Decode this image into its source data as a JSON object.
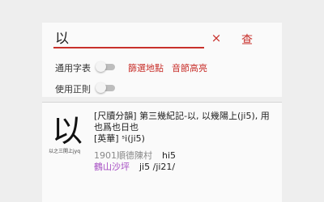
{
  "search": {
    "value": "以",
    "clear_icon": "×",
    "search_label": "查"
  },
  "options": {
    "common_chars_label": "通用字表",
    "filter_locations_label": "篩選地點",
    "highlight_syllable_label": "音節高亮",
    "regex_label": "使用正則"
  },
  "toggles": {
    "common_chars_on": false,
    "regex_on": false
  },
  "result": {
    "character": "以",
    "caption": "以之三開上jyq",
    "line1": "[尺牘分韻] 第三幾紀記-以, 以幾陽上(ji5), 用",
    "line2": "也爲也日也",
    "line3": "[英華] ˢi(ji5)",
    "entries": [
      {
        "place": "1901順德陳村",
        "reading": "hi5"
      },
      {
        "place": "鶴山沙坪",
        "reading": "ji5 /ji21/"
      }
    ],
    "colors": {
      "accent": "#c8302b",
      "place_gray": "#8a8a8a",
      "place_purple": "#a64ec3"
    }
  }
}
